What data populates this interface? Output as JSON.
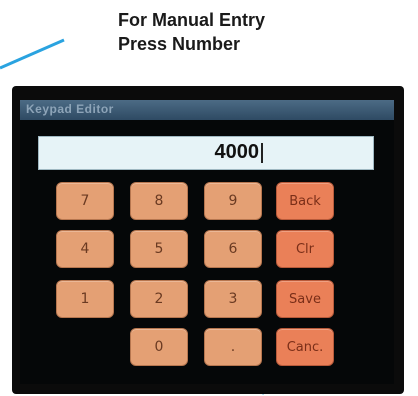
{
  "callout": {
    "line1": "For Manual Entry",
    "line2": "Press Number"
  },
  "window": {
    "title": "Keypad Editor"
  },
  "display": {
    "value": "4000"
  },
  "keys": {
    "k7": "7",
    "k8": "8",
    "k9": "9",
    "back": "Back",
    "k4": "4",
    "k5": "5",
    "k6": "6",
    "clr": "Clr",
    "k1": "1",
    "k2": "2",
    "k3": "3",
    "save": "Save",
    "k0": "0",
    "dot": ".",
    "cancel": "Canc."
  },
  "colors": {
    "key": "#e4a074",
    "action_key": "#ea8058",
    "display_bg": "#e6f3f7",
    "pointer": "#2aa3e0"
  }
}
